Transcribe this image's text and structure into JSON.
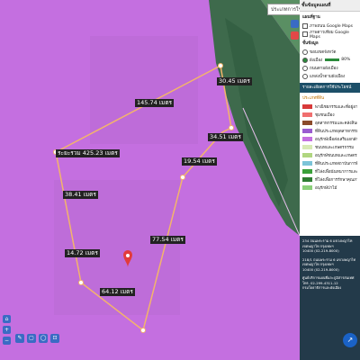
{
  "map": {
    "search": {
      "text": "ประเภทการใช้ประโยชน์ที่ดิน"
    },
    "measurements": [
      {
        "id": "m1",
        "label": "145.74 เมตร"
      },
      {
        "id": "m2",
        "label": "30.45 เมตร"
      },
      {
        "id": "m3",
        "label": "34.51 เมตร"
      },
      {
        "id": "m4",
        "label": "19.54 เมตร"
      },
      {
        "id": "m5",
        "label": "ระยะรวม 425.23 เมตร"
      },
      {
        "id": "m6",
        "label": "38.41 เมตร"
      },
      {
        "id": "m7",
        "label": "77.54 เมตร"
      },
      {
        "id": "m8",
        "label": "14.72 เมตร"
      },
      {
        "id": "m9",
        "label": "64.12 เมตร"
      }
    ],
    "colors": {
      "zone": "#c46fe0",
      "line": "#f3b46b",
      "forest": "#3e6a4c",
      "pin": "#e23b3b"
    }
  },
  "panel": {
    "header": "ชั้นข้อมูลแผนที่",
    "basemap_title": "แผนที่ฐาน",
    "basemaps": [
      {
        "label": "ภาพถนน Google Maps",
        "type": "check"
      },
      {
        "label": "ภาพดาวเทียม Google Maps",
        "type": "check"
      }
    ],
    "layers_title": "ชั้นข้อมูล",
    "layers": [
      {
        "label": "ขอบเขตจังหวัด",
        "type": "dot"
      },
      {
        "label": "ผังเมือง",
        "type": "dot",
        "opacity": "80%"
      },
      {
        "label": "ถนนตามผังเมือง",
        "type": "dot"
      },
      {
        "label": "แหล่งน้ำตามผังเมือง",
        "type": "dot"
      }
    ],
    "legend_title": "รายละเอียดการใช้ประโยชน์ที่ดินตามผังเมือง",
    "legend_sub": "ประเภทที่ดิน",
    "legend": [
      {
        "label": "พาณิชยกรรมและที่อยู่อาศัย",
        "color": "#d83a3a"
      },
      {
        "label": "ชุมชนเมือง",
        "color": "#f06f6f"
      },
      {
        "label": "อุตสาหกรรมและคลังสินค้า",
        "color": "#8b4a2b"
      },
      {
        "label": "ที่ดินประเภทอุตสาหกรรม",
        "color": "#9a5bd0"
      },
      {
        "label": "อนุรักษ์เพื่อส่งเสริมเอกลักษณ์ศิลปวัฒนธรรมไทย",
        "color": "#c46fe0"
      },
      {
        "label": "ชนบทและเกษตรกรรม",
        "color": "#d8e9b5"
      },
      {
        "label": "อนุรักษ์ชนบทและเกษตรกรรม",
        "color": "#b0d680"
      },
      {
        "label": "ที่ดินประเภทสถาบันการศึกษา",
        "color": "#7cc4d8"
      },
      {
        "label": "ที่โล่งเพื่อนันทนาการและการรักษาคุณภาพสิ่งแวดล้อม",
        "color": "#3aa03a"
      },
      {
        "label": "ที่โล่งเพื่อการรักษาคุณภาพสิ่งแวดล้อม",
        "color": "#2e7d32"
      },
      {
        "label": "อนุรักษ์ป่าไม้",
        "color": "#8bd07a"
      }
    ],
    "footer_lines": [
      "234 ถนนพระราม 6 แขวงพญาไท เขตพญาไท กรุงเทพฯ",
      "10400 (02-219-8000)",
      "218/1 ถนนพระราม 6 แขวงพญาไท เขตพญาไท กรุงเทพฯ",
      "10400 (02-219-8000)",
      "ศูนย์บริการแผนที่และภูมิสารสนเทศ",
      "โทร. 02-299-4311-12",
      "กรมโยธาธิการและผังเมือง"
    ]
  },
  "toolbar": {
    "items": [
      "⌂",
      "+",
      "−"
    ],
    "bottom": [
      "✎",
      "▢",
      "◯",
      "⊡"
    ],
    "fab": "↗"
  }
}
